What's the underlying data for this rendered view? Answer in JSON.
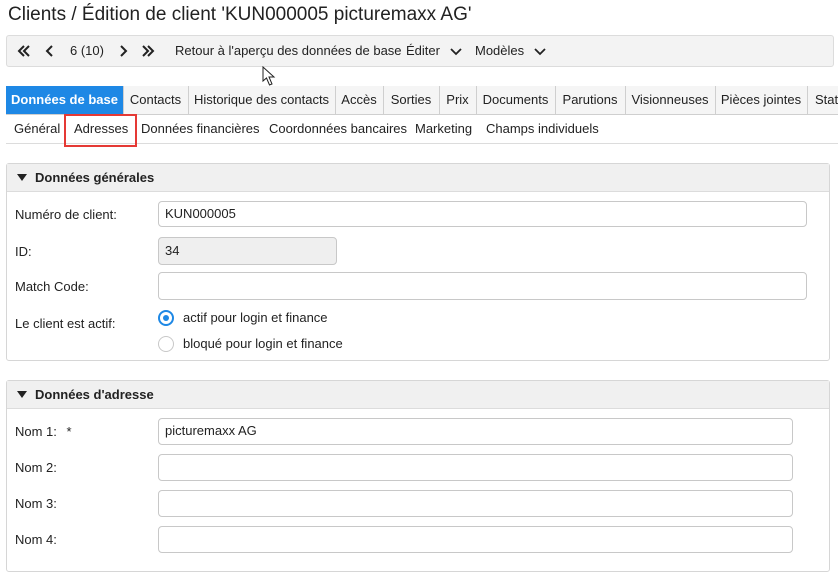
{
  "page_title": "Clients / Édition de client 'KUN000005 picturemaxx AG'",
  "toolbar": {
    "first_icon": "double-chevron-left-icon",
    "prev_icon": "chevron-left-icon",
    "position": "6 (10)",
    "next_icon": "chevron-right-icon",
    "last_icon": "double-chevron-right-icon",
    "back_label": "Retour à l'aperçu des données de base",
    "edit_label": "Éditer",
    "models_label": "Modèles"
  },
  "main_tabs": [
    {
      "label": "Données de base",
      "active": true
    },
    {
      "label": "Contacts"
    },
    {
      "label": "Historique des contacts"
    },
    {
      "label": "Accès"
    },
    {
      "label": "Sorties"
    },
    {
      "label": "Prix"
    },
    {
      "label": "Documents"
    },
    {
      "label": "Parutions"
    },
    {
      "label": "Visionneuses"
    },
    {
      "label": "Pièces jointes"
    },
    {
      "label": "Stat"
    }
  ],
  "sub_tabs": [
    {
      "label": "Général"
    },
    {
      "label": "Adresses",
      "highlighted": true
    },
    {
      "label": "Données financières"
    },
    {
      "label": "Coordonnées bancaires"
    },
    {
      "label": "Marketing"
    },
    {
      "label": "Champs individuels"
    }
  ],
  "general": {
    "heading": "Données générales",
    "client_number_label": "Numéro de client:",
    "client_number_value": "KUN000005",
    "id_label": "ID:",
    "id_value": "34",
    "match_code_label": "Match Code:",
    "match_code_value": "",
    "active_label": "Le client est actif:",
    "radio_active": "actif pour login et finance",
    "radio_blocked": "bloqué pour login et finance"
  },
  "address": {
    "heading": "Données d'adresse",
    "name1_label": "Nom 1:",
    "required_mark": "*",
    "name1_value": "picturemaxx AG",
    "name2_label": "Nom 2:",
    "name2_value": "",
    "name3_label": "Nom 3:",
    "name3_value": "",
    "name4_label": "Nom 4:",
    "name4_value": ""
  },
  "colors": {
    "accent": "#1e88e5",
    "highlight": "#e53935"
  }
}
